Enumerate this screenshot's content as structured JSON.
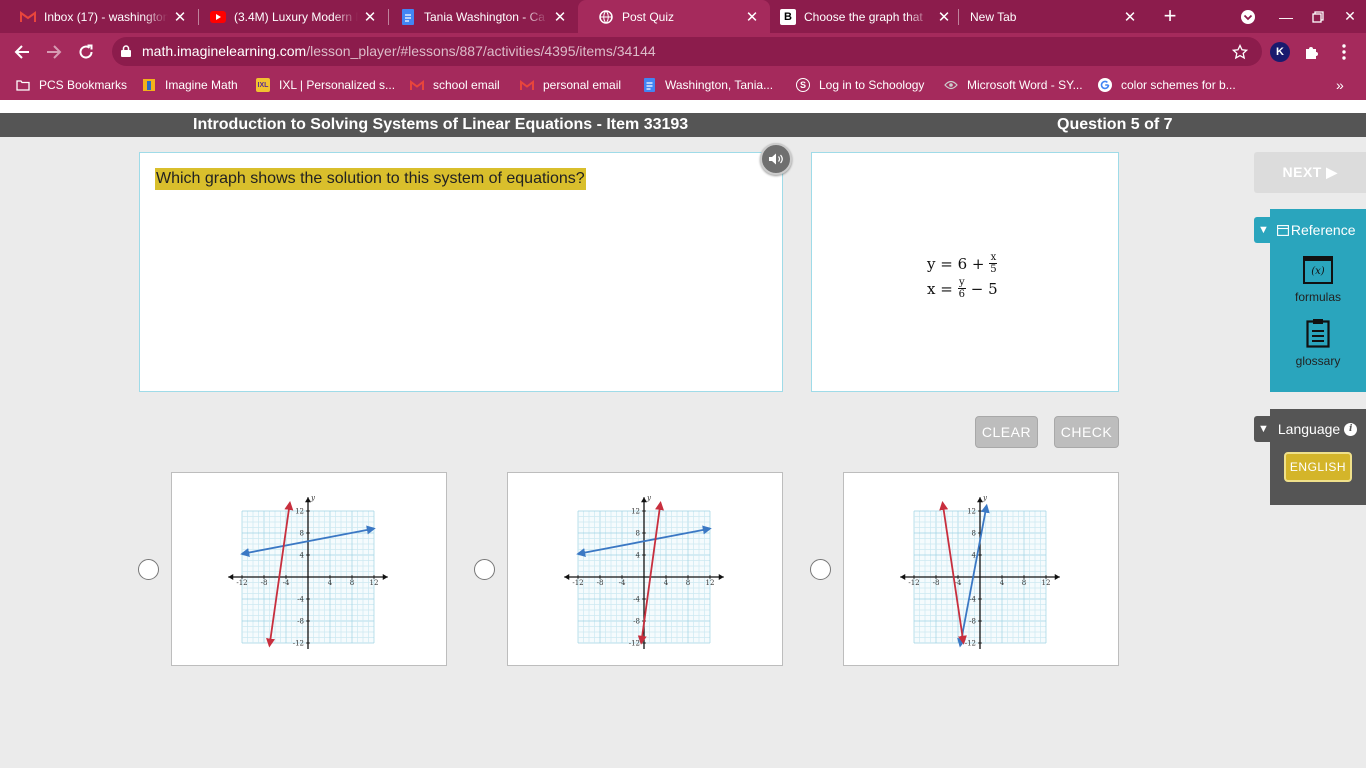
{
  "browser": {
    "tabs": [
      {
        "title": "Inbox (17) - washington",
        "icon": "gmail-icon"
      },
      {
        "title": "(3.4M) Luxury Modern M",
        "icon": "youtube-icon"
      },
      {
        "title": "Tania Washington - Ca",
        "icon": "docs-icon"
      },
      {
        "title": "Post Quiz",
        "icon": "globe-icon"
      },
      {
        "title": "Choose the graph that",
        "icon": "brainly-icon"
      },
      {
        "title": "New Tab",
        "icon": ""
      }
    ],
    "url_host": "math.imaginelearning.com",
    "url_path": "/lesson_player/#lessons/887/activities/4395/items/34144",
    "profile_initial": "K",
    "bookmarks": [
      {
        "label": "PCS Bookmarks",
        "icon": "folder-icon"
      },
      {
        "label": "Imagine Math",
        "icon": "imagine-math-icon"
      },
      {
        "label": "IXL | Personalized s...",
        "icon": "ixl-icon"
      },
      {
        "label": "school email",
        "icon": "gmail-icon"
      },
      {
        "label": "personal email",
        "icon": "gmail-icon"
      },
      {
        "label": "Washington, Tania...",
        "icon": "docs-icon"
      },
      {
        "label": "Log in to Schoology",
        "icon": "schoology-icon"
      },
      {
        "label": "Microsoft Word - SY...",
        "icon": "eye-icon"
      },
      {
        "label": "color schemes for b...",
        "icon": "google-icon"
      }
    ],
    "colors": {
      "frame": "#8c1c4c",
      "toolbar": "#a52a5c"
    }
  },
  "lesson": {
    "title": "Introduction to Solving Systems of Linear Equations - Item 33193",
    "progress": "Question 5 of 7"
  },
  "question": {
    "prompt": "Which graph shows the solution to this system of equations?",
    "eq1_lhs": "y = 6 +",
    "eq1_num": "x",
    "eq1_den": "5",
    "eq2_lhs": "x =",
    "eq2_num": "y",
    "eq2_den": "6",
    "eq2_tail": "− 5"
  },
  "buttons": {
    "clear": "CLEAR",
    "check": "CHECK",
    "next": "NEXT ▶"
  },
  "reference": {
    "header": "Reference",
    "formulas": "formulas",
    "glossary": "glossary",
    "formulas_glyph": "(x)"
  },
  "language": {
    "header": "Language",
    "english": "ENGLISH"
  },
  "graph_ticks": {
    "x": [
      "-12",
      "-8",
      "-4",
      "4",
      "8",
      "12"
    ],
    "y": [
      "12",
      "8",
      "4",
      "-4",
      "-8",
      "-12"
    ],
    "axis_x": "x",
    "axis_y": "y"
  },
  "choices": [
    {
      "blue": [
        [
          -12,
          4.2
        ],
        [
          12,
          8.8
        ]
      ],
      "red": [
        [
          -7,
          -12.5
        ],
        [
          -3.3,
          13.5
        ]
      ]
    },
    {
      "blue": [
        [
          -12,
          4.2
        ],
        [
          12,
          8.8
        ]
      ],
      "red": [
        [
          -0.5,
          -12
        ],
        [
          3,
          13.5
        ]
      ]
    },
    {
      "blue": [
        [
          -3.6,
          -12.5
        ],
        [
          1.2,
          13
        ]
      ],
      "red": [
        [
          -6.8,
          13.5
        ],
        [
          -3,
          -12
        ]
      ]
    }
  ],
  "accent_colors": {
    "teal": "#2aa5bd",
    "highlight": "#d9bf2c",
    "blue_line": "#3b78c4",
    "red_line": "#c82f3e"
  }
}
